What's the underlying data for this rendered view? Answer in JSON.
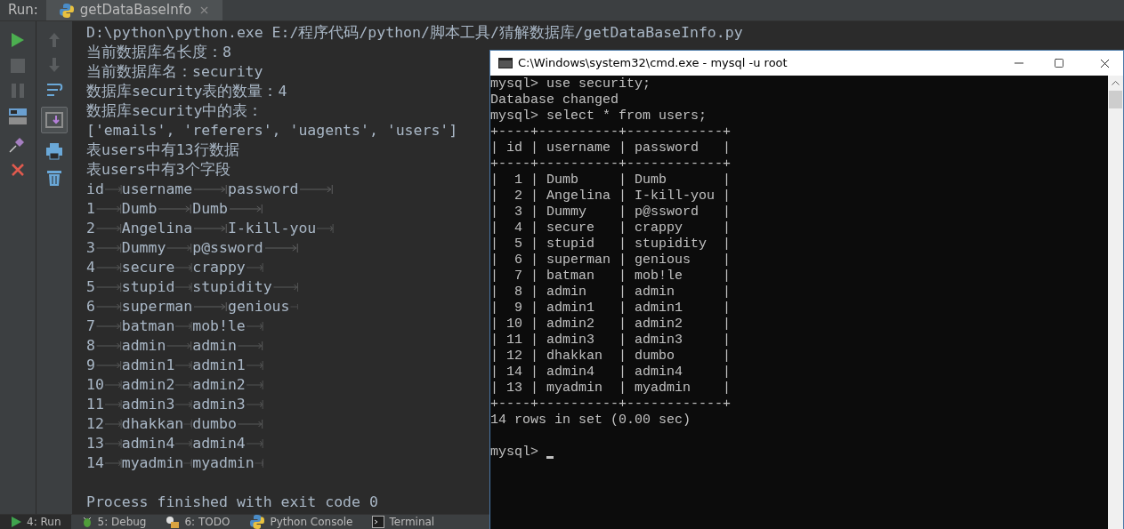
{
  "run_bar": {
    "label": "Run:",
    "tab": {
      "title": "getDataBaseInfo"
    }
  },
  "toolbar": {
    "scroll_to_end": true
  },
  "console": {
    "lines": [
      {
        "kind": "text",
        "text": "D:\\python\\python.exe E:/程序代码/python/脚本工具/猜解数据库/getDataBaseInfo.py"
      },
      {
        "kind": "text",
        "text": "当前数据库名长度：8"
      },
      {
        "kind": "text",
        "text": "当前数据库名：security"
      },
      {
        "kind": "text",
        "text": "数据库security表的数量：4"
      },
      {
        "kind": "text",
        "text": "数据库security中的表："
      },
      {
        "kind": "text",
        "text": "['emails', 'referers', 'uagents', 'users']"
      },
      {
        "kind": "text",
        "text": "表users中有13行数据"
      },
      {
        "kind": "text",
        "text": "表users中有3个字段"
      },
      {
        "kind": "row",
        "cells": [
          "id",
          "username",
          "password"
        ]
      },
      {
        "kind": "row",
        "cells": [
          "1",
          "Dumb",
          "Dumb"
        ]
      },
      {
        "kind": "row",
        "cells": [
          "2",
          "Angelina",
          "I-kill-you"
        ]
      },
      {
        "kind": "row",
        "cells": [
          "3",
          "Dummy",
          "p@ssword"
        ]
      },
      {
        "kind": "row",
        "cells": [
          "4",
          "secure",
          "crappy"
        ]
      },
      {
        "kind": "row",
        "cells": [
          "5",
          "stupid",
          "stupidity"
        ]
      },
      {
        "kind": "row",
        "cells": [
          "6",
          "superman",
          "genious"
        ]
      },
      {
        "kind": "row",
        "cells": [
          "7",
          "batman",
          "mob!le"
        ]
      },
      {
        "kind": "row",
        "cells": [
          "8",
          "admin",
          "admin"
        ]
      },
      {
        "kind": "row",
        "cells": [
          "9",
          "admin1",
          "admin1"
        ]
      },
      {
        "kind": "row",
        "cells": [
          "10",
          "admin2",
          "admin2"
        ]
      },
      {
        "kind": "row",
        "cells": [
          "11",
          "admin3",
          "admin3"
        ]
      },
      {
        "kind": "row",
        "cells": [
          "12",
          "dhakkan",
          "dumbo"
        ]
      },
      {
        "kind": "row",
        "cells": [
          "13",
          "admin4",
          "admin4"
        ]
      },
      {
        "kind": "row",
        "cells": [
          "14",
          "myadmin",
          "myadmin"
        ]
      },
      {
        "kind": "blank"
      },
      {
        "kind": "text",
        "text": "Process finished with exit code 0"
      }
    ]
  },
  "tool_tabs": [
    {
      "label": "4: Run",
      "kind": "run",
      "selected": true
    },
    {
      "label": "5: Debug",
      "kind": "debug",
      "selected": false
    },
    {
      "label": "6: TODO",
      "kind": "todo",
      "selected": false
    },
    {
      "label": "Python Console",
      "kind": "python",
      "selected": false
    },
    {
      "label": "Terminal",
      "kind": "terminal",
      "selected": false
    }
  ],
  "cmd_window": {
    "title": "C:\\Windows\\system32\\cmd.exe - mysql  -u root",
    "lines": [
      "mysql> use security;",
      "Database changed",
      "mysql> select * from users;",
      "+----+----------+------------+",
      "| id | username | password   |",
      "+----+----------+------------+",
      "|  1 | Dumb     | Dumb       |",
      "|  2 | Angelina | I-kill-you |",
      "|  3 | Dummy    | p@ssword   |",
      "|  4 | secure   | crappy     |",
      "|  5 | stupid   | stupidity  |",
      "|  6 | superman | genious    |",
      "|  7 | batman   | mob!le     |",
      "|  8 | admin    | admin      |",
      "|  9 | admin1   | admin1     |",
      "| 10 | admin2   | admin2     |",
      "| 11 | admin3   | admin3     |",
      "| 12 | dhakkan  | dumbo      |",
      "| 14 | admin4   | admin4     |",
      "| 13 | myadmin  | myadmin    |",
      "+----+----------+------------+",
      "14 rows in set (0.00 sec)"
    ],
    "prompt": "mysql>"
  }
}
